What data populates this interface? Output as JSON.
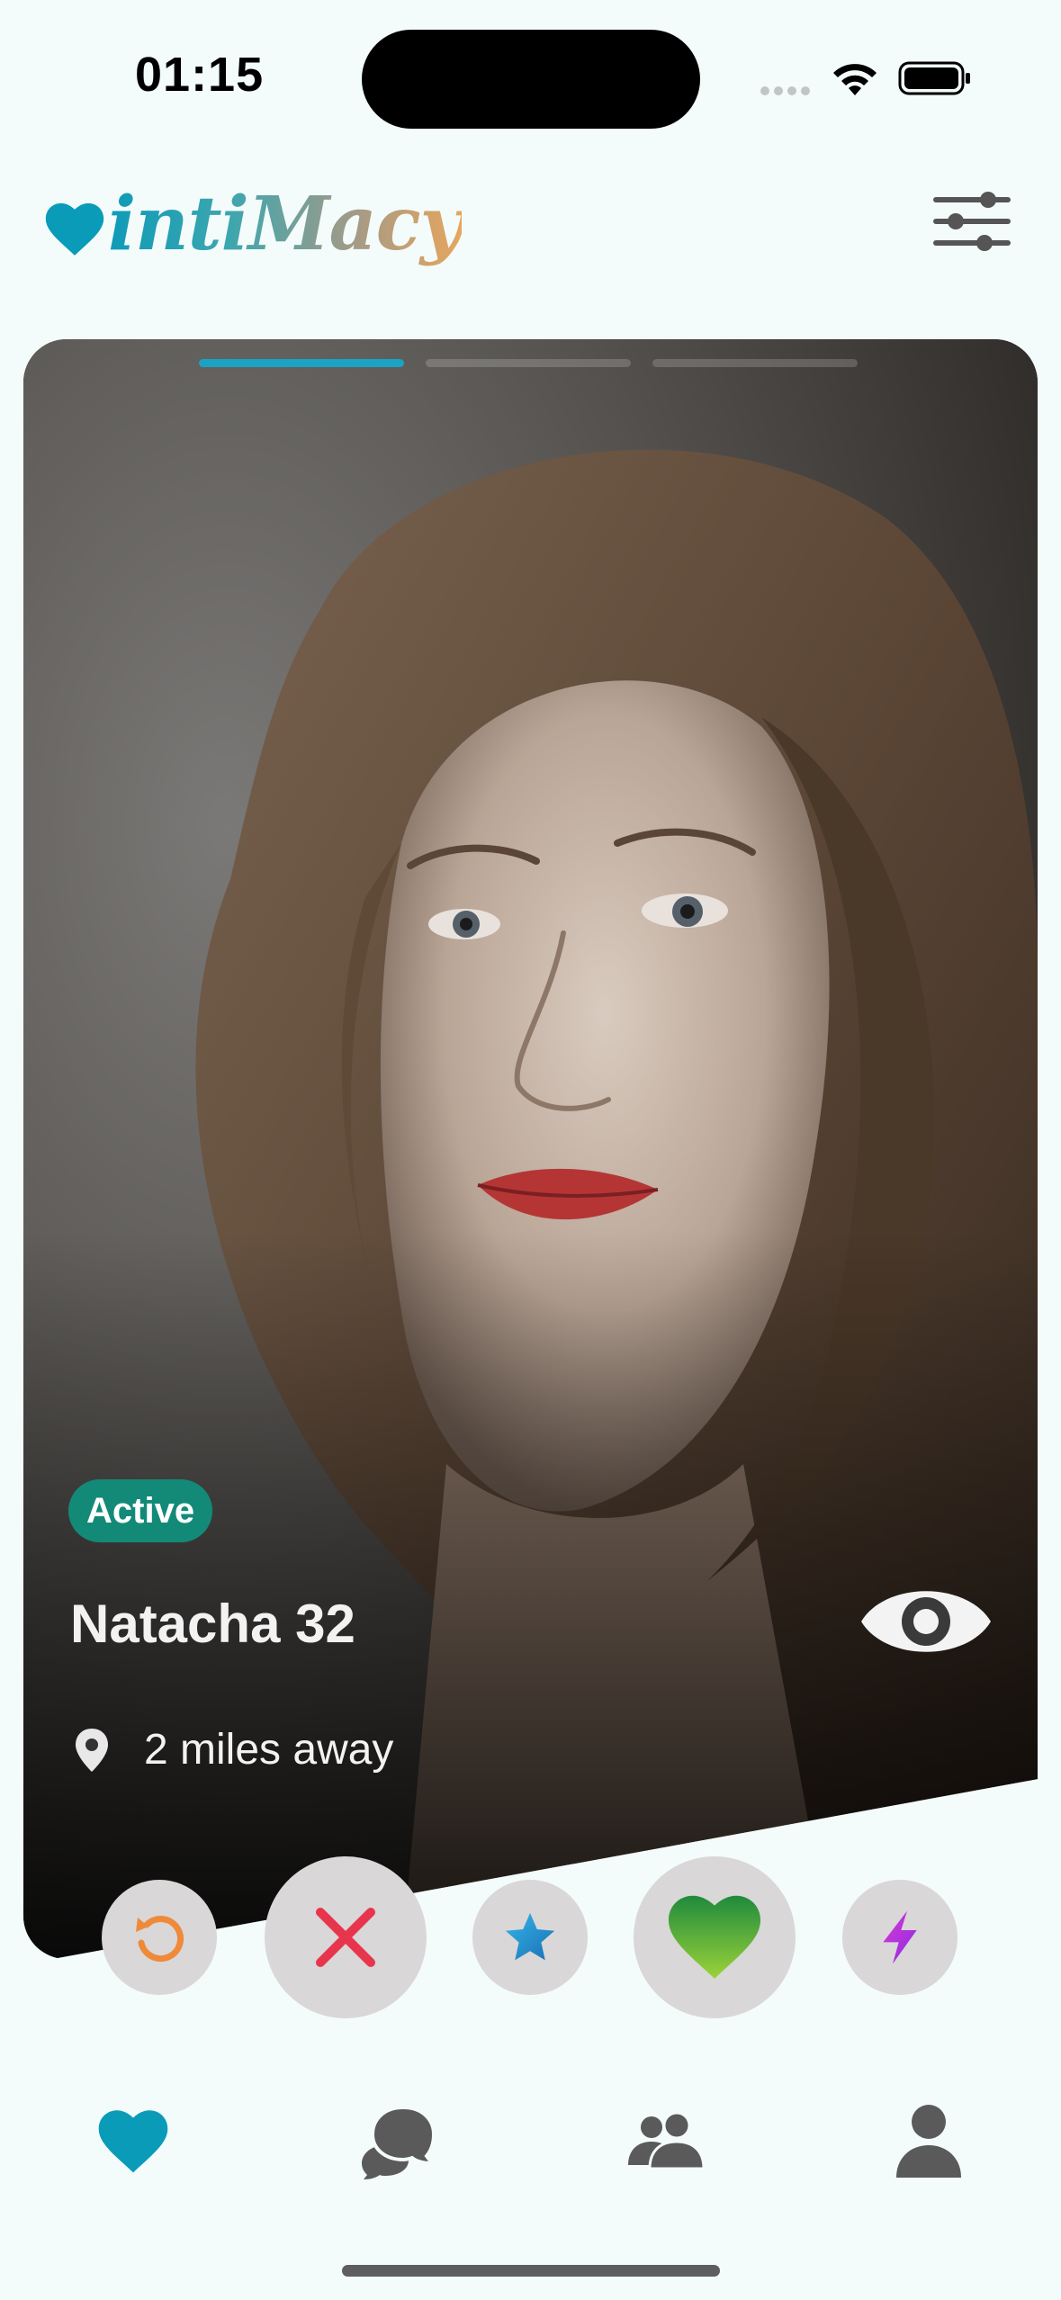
{
  "status_bar": {
    "time": "01:15"
  },
  "header": {
    "app_name": "intiMacy"
  },
  "card": {
    "photo_count": 3,
    "active_photo_index": 0,
    "status_badge": "Active",
    "name_age": "Natacha 32",
    "distance": "2 miles away"
  },
  "actions": [
    "undo-icon",
    "close-icon",
    "star-icon",
    "heart-icon",
    "bolt-icon"
  ],
  "tab_bar": {
    "items": [
      {
        "icon": "heart-icon",
        "active": true
      },
      {
        "icon": "chat-icon",
        "active": false
      },
      {
        "icon": "people-icon",
        "active": false
      },
      {
        "icon": "person-icon",
        "active": false
      }
    ]
  },
  "colors": {
    "accent": "#0a9bb9",
    "badge": "#138a78",
    "background": "#f3fcfb",
    "nope": "#e8354e",
    "undo": "#ef8a3a",
    "like": "#4caf3e"
  }
}
